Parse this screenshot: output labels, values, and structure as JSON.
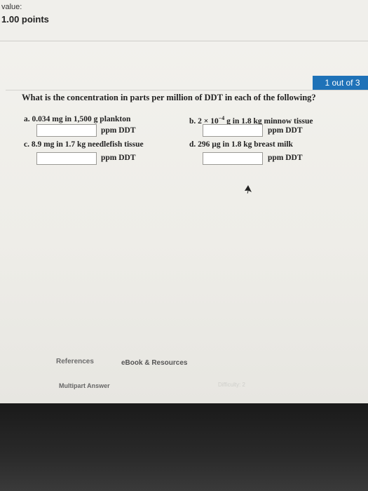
{
  "header": {
    "value_label": "value:",
    "points": "1.00 points"
  },
  "progress": {
    "label": "1 out of 3"
  },
  "question": "What is the concentration in parts per million of DDT in each of the following?",
  "parts": {
    "a": {
      "label": "a. 0.034 mg in 1,500 g plankton",
      "unit": "ppm DDT",
      "value": ""
    },
    "b": {
      "label_pre": "b. 2 × 10",
      "exponent": "−4",
      "label_post": " g in 1.8 kg minnow tissue",
      "unit": "ppm DDT",
      "value": ""
    },
    "c": {
      "label": "c. 8.9 mg in 1.7 kg needlefish tissue",
      "unit": "ppm DDT",
      "value": ""
    },
    "d": {
      "label": "d. 296 µg in 1.8 kg breast milk",
      "unit": "ppm DDT",
      "value": ""
    }
  },
  "footer": {
    "references": "References",
    "ebook": "eBook & Resources",
    "multipart": "Multipart Answer",
    "difficulty": "Difficulty: 2"
  },
  "icons": {
    "cursor": "mouse-pointer-icon"
  },
  "colors": {
    "accent": "#1f72b8"
  }
}
